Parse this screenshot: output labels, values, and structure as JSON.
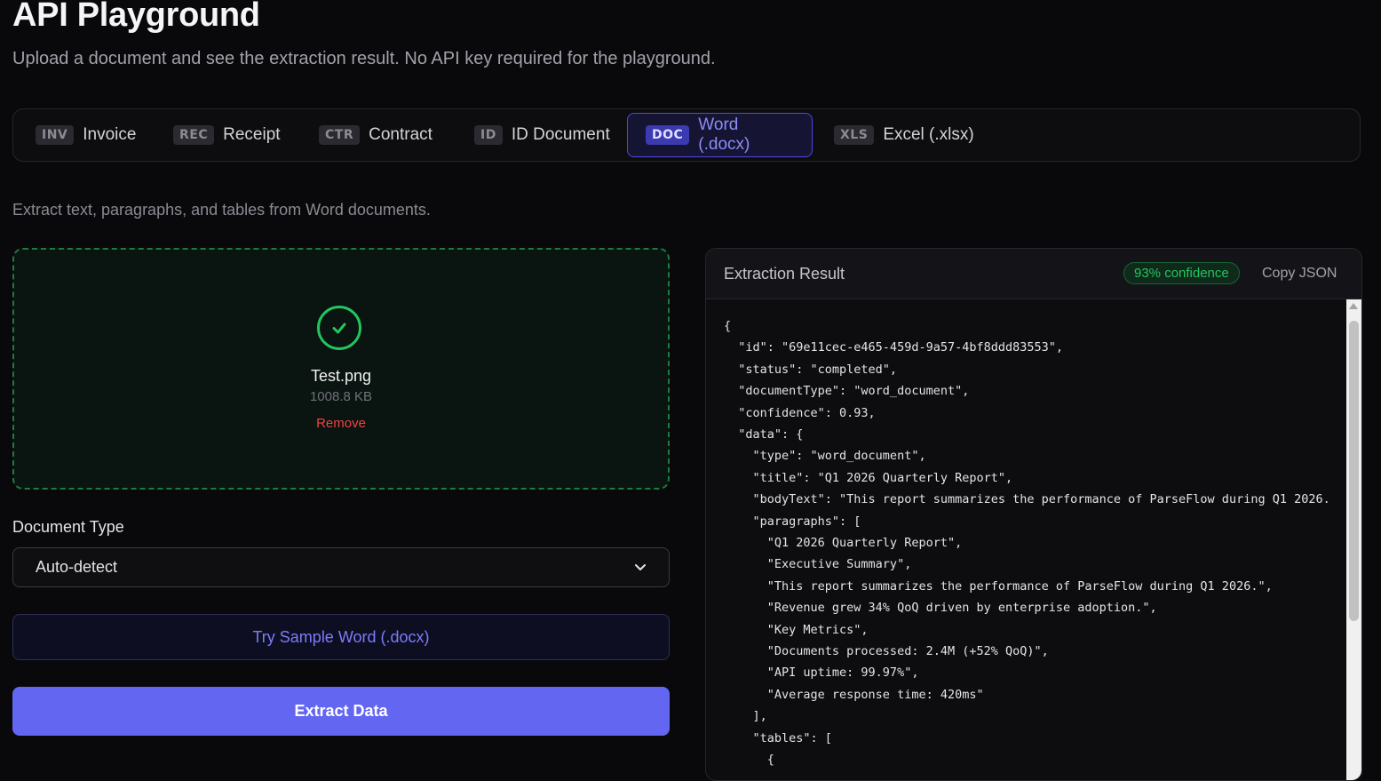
{
  "header": {
    "title": "API Playground",
    "subtitle": "Upload a document and see the extraction result. No API key required for the playground."
  },
  "tabs": [
    {
      "tag": "INV",
      "label": "Invoice",
      "active": false
    },
    {
      "tag": "REC",
      "label": "Receipt",
      "active": false
    },
    {
      "tag": "CTR",
      "label": "Contract",
      "active": false
    },
    {
      "tag": "ID",
      "label": "ID Document",
      "active": false
    },
    {
      "tag": "DOC",
      "label": "Word (.docx)",
      "active": true
    },
    {
      "tag": "XLS",
      "label": "Excel (.xlsx)",
      "active": false
    }
  ],
  "description": "Extract text, paragraphs, and tables from Word documents.",
  "upload": {
    "file_name": "Test.png",
    "file_size": "1008.8 KB",
    "remove_label": "Remove",
    "status_icon": "check-circle-icon"
  },
  "document_type": {
    "label": "Document Type",
    "selected": "Auto-detect"
  },
  "buttons": {
    "sample": "Try Sample Word (.docx)",
    "extract": "Extract Data"
  },
  "result": {
    "title": "Extraction Result",
    "confidence_badge": "93% confidence",
    "copy_label": "Copy JSON",
    "json_lines": [
      "{",
      "  \"id\": \"69e11cec-e465-459d-9a57-4bf8ddd83553\",",
      "  \"status\": \"completed\",",
      "  \"documentType\": \"word_document\",",
      "  \"confidence\": 0.93,",
      "  \"data\": {",
      "    \"type\": \"word_document\",",
      "    \"title\": \"Q1 2026 Quarterly Report\",",
      "    \"bodyText\": \"This report summarizes the performance of ParseFlow during Q1 2026.",
      "    \"paragraphs\": [",
      "      \"Q1 2026 Quarterly Report\",",
      "      \"Executive Summary\",",
      "      \"This report summarizes the performance of ParseFlow during Q1 2026.\",",
      "      \"Revenue grew 34% QoQ driven by enterprise adoption.\",",
      "      \"Key Metrics\",",
      "      \"Documents processed: 2.4M (+52% QoQ)\",",
      "      \"API uptime: 99.97%\",",
      "      \"Average response time: 420ms\"",
      "    ],",
      "    \"tables\": [",
      "      {"
    ]
  },
  "colors": {
    "accent": "#6366f1",
    "success": "#22c55e",
    "danger": "#ef4444",
    "background": "#09090b"
  }
}
